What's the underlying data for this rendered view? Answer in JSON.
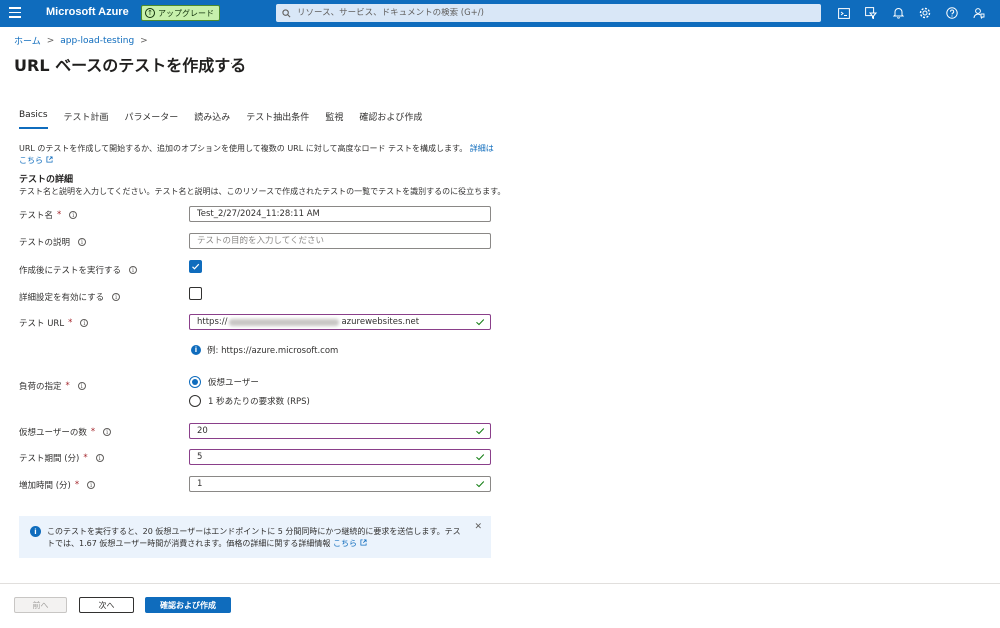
{
  "topbar": {
    "brand": "Microsoft Azure",
    "upgrade_label": "アップグレード",
    "search_placeholder": "リソース、サービス、ドキュメントの検索 (G+/)"
  },
  "breadcrumb": {
    "home": "ホーム",
    "resource": "app-load-testing"
  },
  "page": {
    "title": "URL ベースのテストを作成する",
    "more": "..."
  },
  "tabs": [
    "Basics",
    "テスト計画",
    "パラメーター",
    "読み込み",
    "テスト抽出条件",
    "監視",
    "確認および作成"
  ],
  "intro": {
    "text": "URL のテストを作成して開始するか、追加のオプションを使用して複数の URL に対して高度なロード テストを構成します。",
    "link": "詳細はこちら"
  },
  "section": {
    "title": "テストの詳細",
    "description": "テスト名と説明を入力してください。テスト名と説明は、このリソースで作成されたテストの一覧でテストを識別するのに役立ちます。"
  },
  "form": {
    "test_name_label": "テスト名",
    "test_name_value": "Test_2/27/2024_11:28:11 AM",
    "test_desc_label": "テストの説明",
    "test_desc_placeholder": "テストの目的を入力してください",
    "run_after_label": "作成後にテストを実行する",
    "advanced_label": "詳細設定を有効にする",
    "url_label": "テスト URL",
    "url_prefix": "https://",
    "url_suffix": "azurewebsites.net",
    "url_hint": "例: https://azure.microsoft.com",
    "load_label": "負荷の指定",
    "radio_virtual_users": "仮想ユーザー",
    "radio_rps": "1 秒あたりの要求数 (RPS)",
    "vu_label": "仮想ユーザーの数",
    "vu_value": "20",
    "duration_label": "テスト期間 (分)",
    "duration_value": "5",
    "rampup_label": "増加時間 (分)",
    "rampup_value": "1",
    "required_mark": "*"
  },
  "banner": {
    "text": "このテストを実行すると、20 仮想ユーザーはエンドポイントに 5 分間同時にかつ継続的に要求を送信します。テストでは、1.67 仮想ユーザー時間が消費されます。価格の詳細に関する詳細情報",
    "link": "こちら"
  },
  "footer": {
    "prev": "前へ",
    "next": "次へ",
    "review": "確認および作成"
  },
  "colors": {
    "accent": "#0f6cbd",
    "valid_border": "#8a3f8a",
    "check": "#107c10"
  }
}
